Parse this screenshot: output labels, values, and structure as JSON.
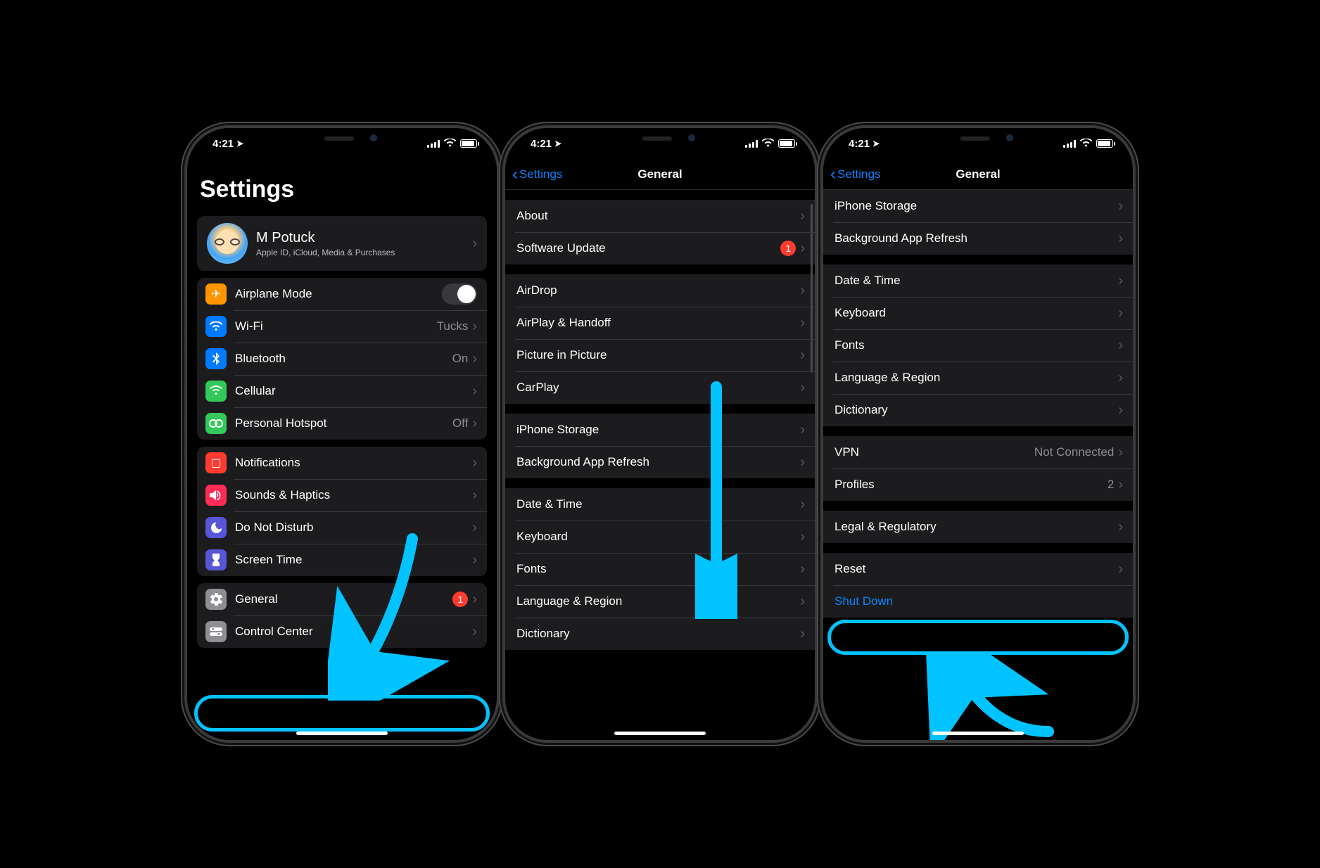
{
  "status": {
    "time": "4:21",
    "location_icon": "➤"
  },
  "panel1": {
    "title": "Settings",
    "profile": {
      "name": "M Potuck",
      "subtitle": "Apple ID, iCloud, Media & Purchases"
    },
    "groupA": [
      {
        "icon": "airplane",
        "label": "Airplane Mode",
        "type": "toggle"
      },
      {
        "icon": "wifi",
        "label": "Wi-Fi",
        "value": "Tucks"
      },
      {
        "icon": "bluetooth",
        "label": "Bluetooth",
        "value": "On"
      },
      {
        "icon": "cellular",
        "label": "Cellular"
      },
      {
        "icon": "hotspot",
        "label": "Personal Hotspot",
        "value": "Off"
      }
    ],
    "groupB": [
      {
        "icon": "notifications",
        "label": "Notifications"
      },
      {
        "icon": "sounds",
        "label": "Sounds & Haptics"
      },
      {
        "icon": "dnd",
        "label": "Do Not Disturb"
      },
      {
        "icon": "screentime",
        "label": "Screen Time"
      }
    ],
    "groupC": [
      {
        "icon": "general",
        "label": "General",
        "badge": "1"
      },
      {
        "icon": "controlcenter",
        "label": "Control Center"
      }
    ]
  },
  "panel2": {
    "back": "Settings",
    "title": "General",
    "groups": [
      [
        {
          "label": "About"
        },
        {
          "label": "Software Update",
          "badge": "1"
        }
      ],
      [
        {
          "label": "AirDrop"
        },
        {
          "label": "AirPlay & Handoff"
        },
        {
          "label": "Picture in Picture"
        },
        {
          "label": "CarPlay"
        }
      ],
      [
        {
          "label": "iPhone Storage"
        },
        {
          "label": "Background App Refresh"
        }
      ],
      [
        {
          "label": "Date & Time"
        },
        {
          "label": "Keyboard"
        },
        {
          "label": "Fonts"
        },
        {
          "label": "Language & Region"
        },
        {
          "label": "Dictionary"
        }
      ]
    ]
  },
  "panel3": {
    "back": "Settings",
    "title": "General",
    "groups": [
      [
        {
          "label": "iPhone Storage"
        },
        {
          "label": "Background App Refresh"
        }
      ],
      [
        {
          "label": "Date & Time"
        },
        {
          "label": "Keyboard"
        },
        {
          "label": "Fonts"
        },
        {
          "label": "Language & Region"
        },
        {
          "label": "Dictionary"
        }
      ],
      [
        {
          "label": "VPN",
          "value": "Not Connected"
        },
        {
          "label": "Profiles",
          "value": "2"
        }
      ],
      [
        {
          "label": "Legal & Regulatory"
        }
      ],
      [
        {
          "label": "Reset"
        },
        {
          "label": "Shut Down",
          "blue": true,
          "nochev": true
        }
      ]
    ]
  },
  "annotation": {
    "highlight_color": "#00c3ff"
  }
}
